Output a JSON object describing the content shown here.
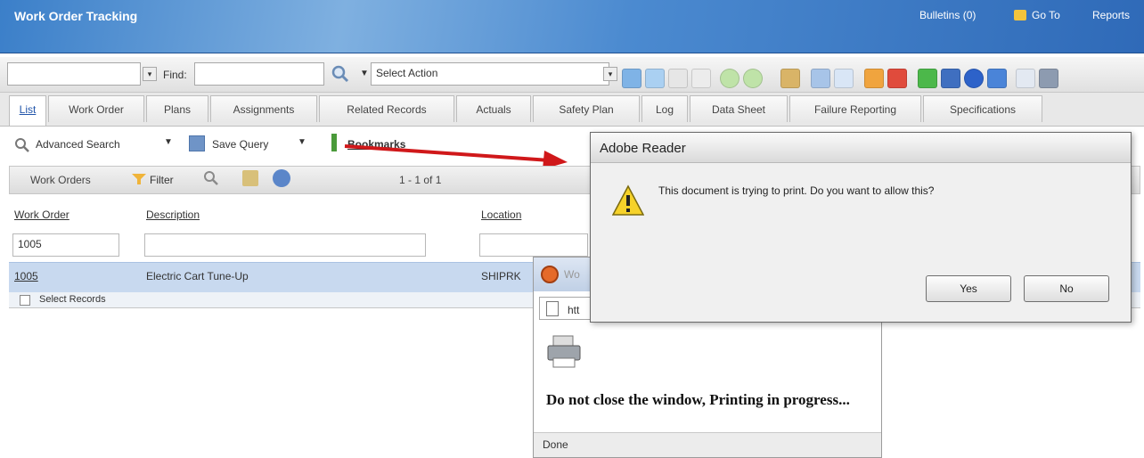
{
  "header": {
    "title": "Work Order Tracking",
    "links": [
      "Bulletins (0)",
      "Go To",
      "Reports"
    ]
  },
  "toolbar": {
    "find_label": "Find:",
    "find_value": "",
    "select_action": "Select Action"
  },
  "tabs": [
    "List",
    "Work Order",
    "Plans",
    "Assignments",
    "Related Records",
    "Actuals",
    "Safety Plan",
    "Log",
    "Data Sheet",
    "Failure Reporting",
    "Specifications"
  ],
  "query": {
    "advanced_search": "Advanced Search",
    "save_query": "Save Query",
    "bookmarks": "Bookmarks"
  },
  "list": {
    "title": "Work Orders",
    "filter": "Filter",
    "paging": "1 - 1 of 1",
    "columns": [
      "Work Order",
      "Description",
      "Location"
    ],
    "filter_values": [
      "1005",
      "",
      ""
    ],
    "row": {
      "work_order": "1005",
      "description": "Electric Cart Tune-Up",
      "location": "SHIPRK"
    },
    "select_records": "Select Records"
  },
  "popup": {
    "title_text": "Wo",
    "address_text": "htt",
    "message": "Do not close the window, Printing in progress...",
    "status": "Done"
  },
  "dialog": {
    "title": "Adobe Reader",
    "message": "This document is trying to print. Do you want to allow this?",
    "yes": "Yes",
    "no": "No"
  },
  "colors": {
    "header_blue": "#3b7fc9",
    "selected_row": "#c8d9ef",
    "arrow_red": "#d0181a"
  }
}
